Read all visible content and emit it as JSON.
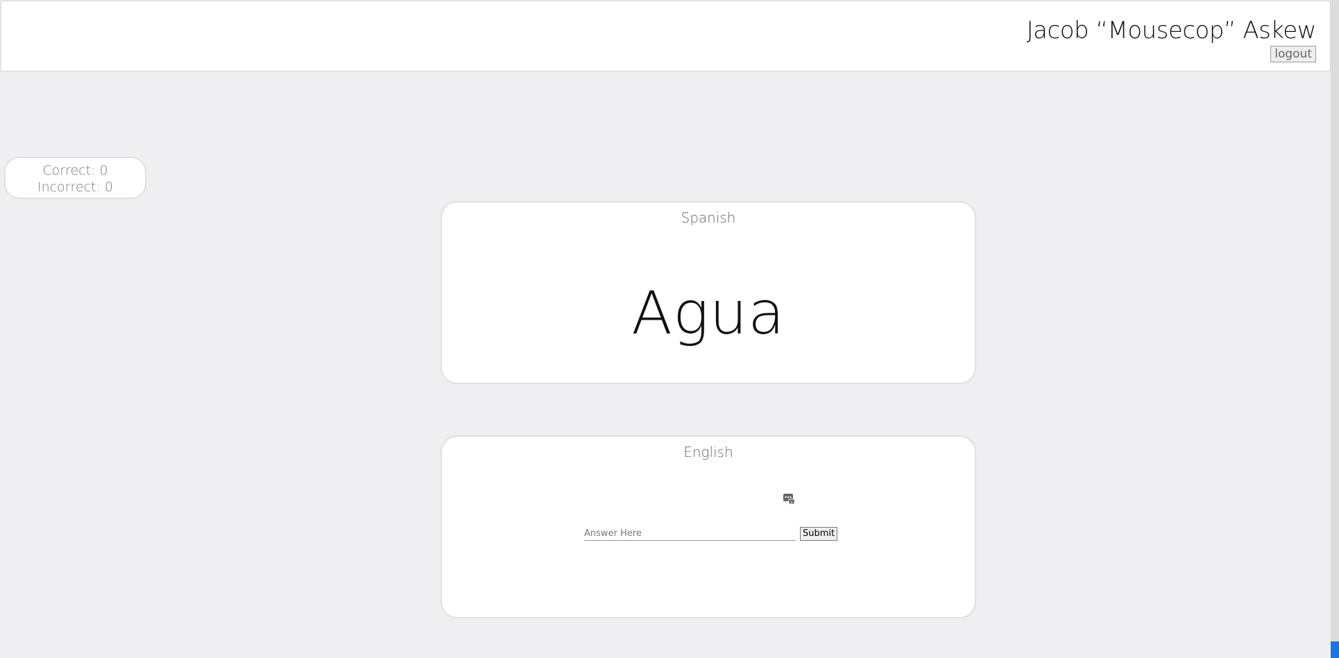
{
  "header": {
    "user_name": "Jacob “Mousecop” Askew",
    "logout_label": "logout"
  },
  "score": {
    "correct_label": "Correct: 0",
    "incorrect_label": "Incorrect: 0"
  },
  "spanish_card": {
    "title": "Spanish",
    "word": "Agua"
  },
  "english_card": {
    "title": "English",
    "answer_placeholder": "Answer Here",
    "answer_value": "",
    "submit_label": "Submit",
    "icon": "dictionary-icon"
  },
  "colors": {
    "background": "#efeff1",
    "card_background": "#ffffff",
    "card_border": "#e0e0e2",
    "scroll_accent": "#1a73e8"
  }
}
